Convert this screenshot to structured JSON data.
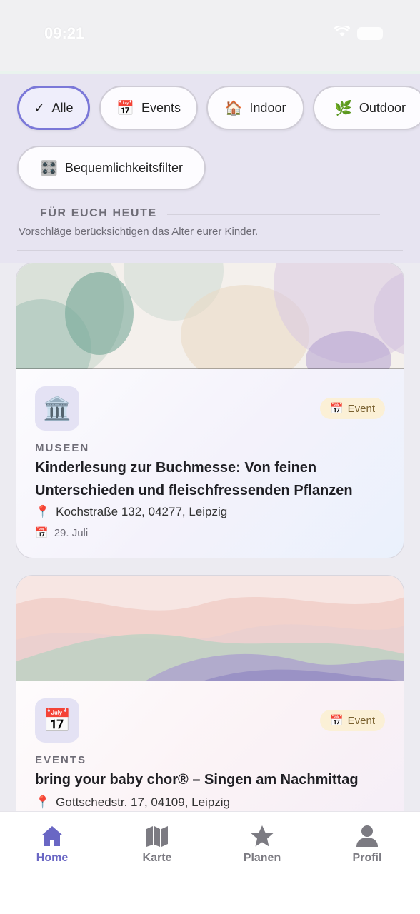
{
  "status_bar": {
    "time": "09:21"
  },
  "filters": {
    "chips": [
      {
        "icon": "checkmark-icon",
        "glyph": "✓",
        "label": "Alle",
        "active": true
      },
      {
        "icon": "calendar-icon",
        "glyph": "📅",
        "label": "Events",
        "active": false
      },
      {
        "icon": "house-icon",
        "glyph": "🏠",
        "label": "Indoor",
        "active": false
      },
      {
        "icon": "leaf-icon",
        "glyph": "🌿",
        "label": "Outdoor",
        "active": false
      },
      {
        "icon": "control-knobs-icon",
        "glyph": "🎛️",
        "label": "Bequemlichkeitsfilter",
        "active": false
      }
    ]
  },
  "section": {
    "heading": "FÜR EUCH HEUTE",
    "subtitle": "Vorschläge berücksichtigen das Alter eurer Kinder."
  },
  "cards": [
    {
      "icon": "museum-icon",
      "glyph": "🏛️",
      "badge_glyph": "📅",
      "badge": "Event",
      "category": "MUSEEN",
      "title": "Kinderlesung zur Buchmesse: Von feinen Unterschieden und fleischfressenden Pflanzen",
      "address_glyph": "📍",
      "address": "Kochstraße 132, 04277, Leipzig",
      "date_glyph": "📅",
      "date": "29. Juli"
    },
    {
      "icon": "calendar-icon",
      "glyph": "📅",
      "badge_glyph": "📅",
      "badge": "Event",
      "category": "EVENTS",
      "title": "bring your baby chor® – Singen am Nachmittag",
      "address_glyph": "📍",
      "address": "Gottschedstr. 17, 04109, Leipzig"
    }
  ],
  "nav": {
    "home": "Home",
    "map": "Karte",
    "plan": "Planen",
    "profile": "Profil"
  },
  "colors": {
    "accent": "#6a67c4",
    "chip_active_border": "#7b78d8",
    "badge_bg": "#fbf0d6",
    "filter_bg": "#e7e4f1"
  }
}
